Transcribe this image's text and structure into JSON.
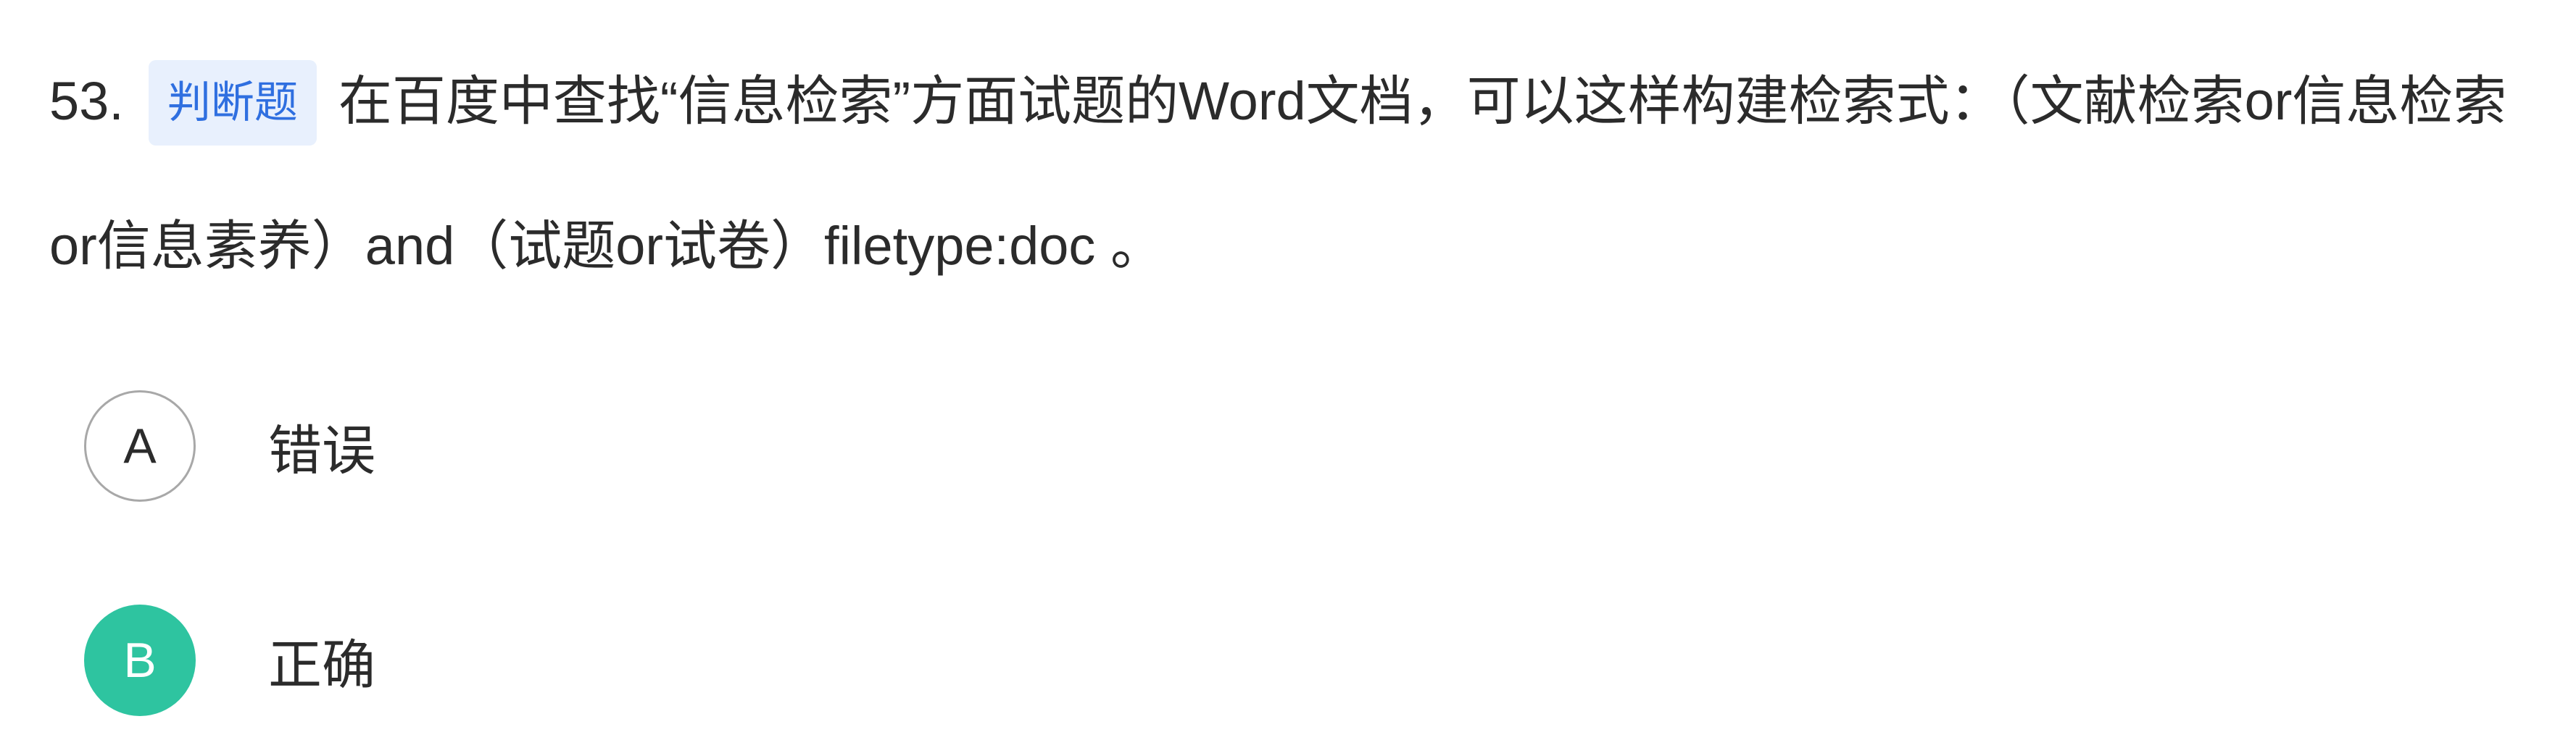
{
  "question": {
    "number": "53.",
    "type_badge": "判断题",
    "text": "在百度中查找“信息检索”方面试题的Word文档，可以这样构建检索式：（文献检索or信息检索or信息素养）and（试题or试卷）filetype:doc 。"
  },
  "options": [
    {
      "letter": "A",
      "text": "错误",
      "selected": false
    },
    {
      "letter": "B",
      "text": "正确",
      "selected": true
    }
  ],
  "colors": {
    "badge_bg": "#e8f0fd",
    "badge_text": "#2f6fe0",
    "selected": "#2ec4a0",
    "text": "#2b2b2b"
  }
}
